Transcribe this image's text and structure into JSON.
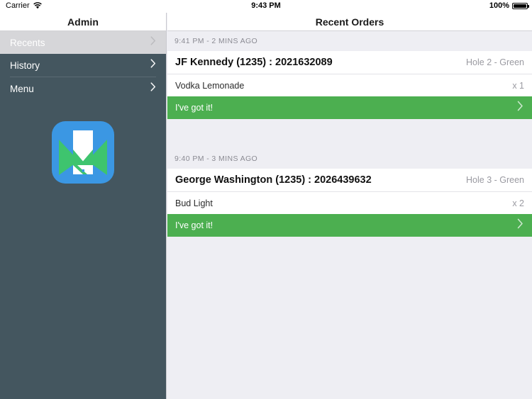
{
  "status_bar": {
    "carrier": "Carrier",
    "wifi_icon": "wifi-icon",
    "time": "9:43 PM",
    "battery_percent": "100%",
    "battery_icon": "battery-full-icon"
  },
  "sidebar": {
    "title": "Admin",
    "items": [
      {
        "label": "Recents",
        "selected": true,
        "chevron_icon": "chevron-right-icon"
      },
      {
        "label": "History",
        "selected": false,
        "chevron_icon": "chevron-right-icon"
      },
      {
        "label": "Menu",
        "selected": false,
        "chevron_icon": "chevron-right-icon"
      }
    ],
    "logo": {
      "name": "app-logo-icon",
      "background_color": "#3b97e3",
      "accent_color": "#3ec46e",
      "device_color": "#ffffff"
    },
    "background_color": "#44565f",
    "selected_background_color": "#d6d6d9"
  },
  "detail": {
    "title": "Recent Orders",
    "accent_color": "#4caf50",
    "background_color": "#eeeef3",
    "orders": [
      {
        "timestamp": "9:41 PM - 2 MINS AGO",
        "customer": "JF Kennedy (1235) : 2021632089",
        "location": "Hole 2 - Green",
        "items": [
          {
            "name": "Vodka Lemonade",
            "qty": "x 1"
          }
        ],
        "action_label": "I've got it!",
        "action_chevron_icon": "chevron-right-icon"
      },
      {
        "timestamp": "9:40 PM - 3 MINS AGO",
        "customer": "George Washington (1235) : 2026439632",
        "location": "Hole 3 - Green",
        "items": [
          {
            "name": "Bud Light",
            "qty": "x 2"
          }
        ],
        "action_label": "I've got it!",
        "action_chevron_icon": "chevron-right-icon"
      }
    ]
  }
}
